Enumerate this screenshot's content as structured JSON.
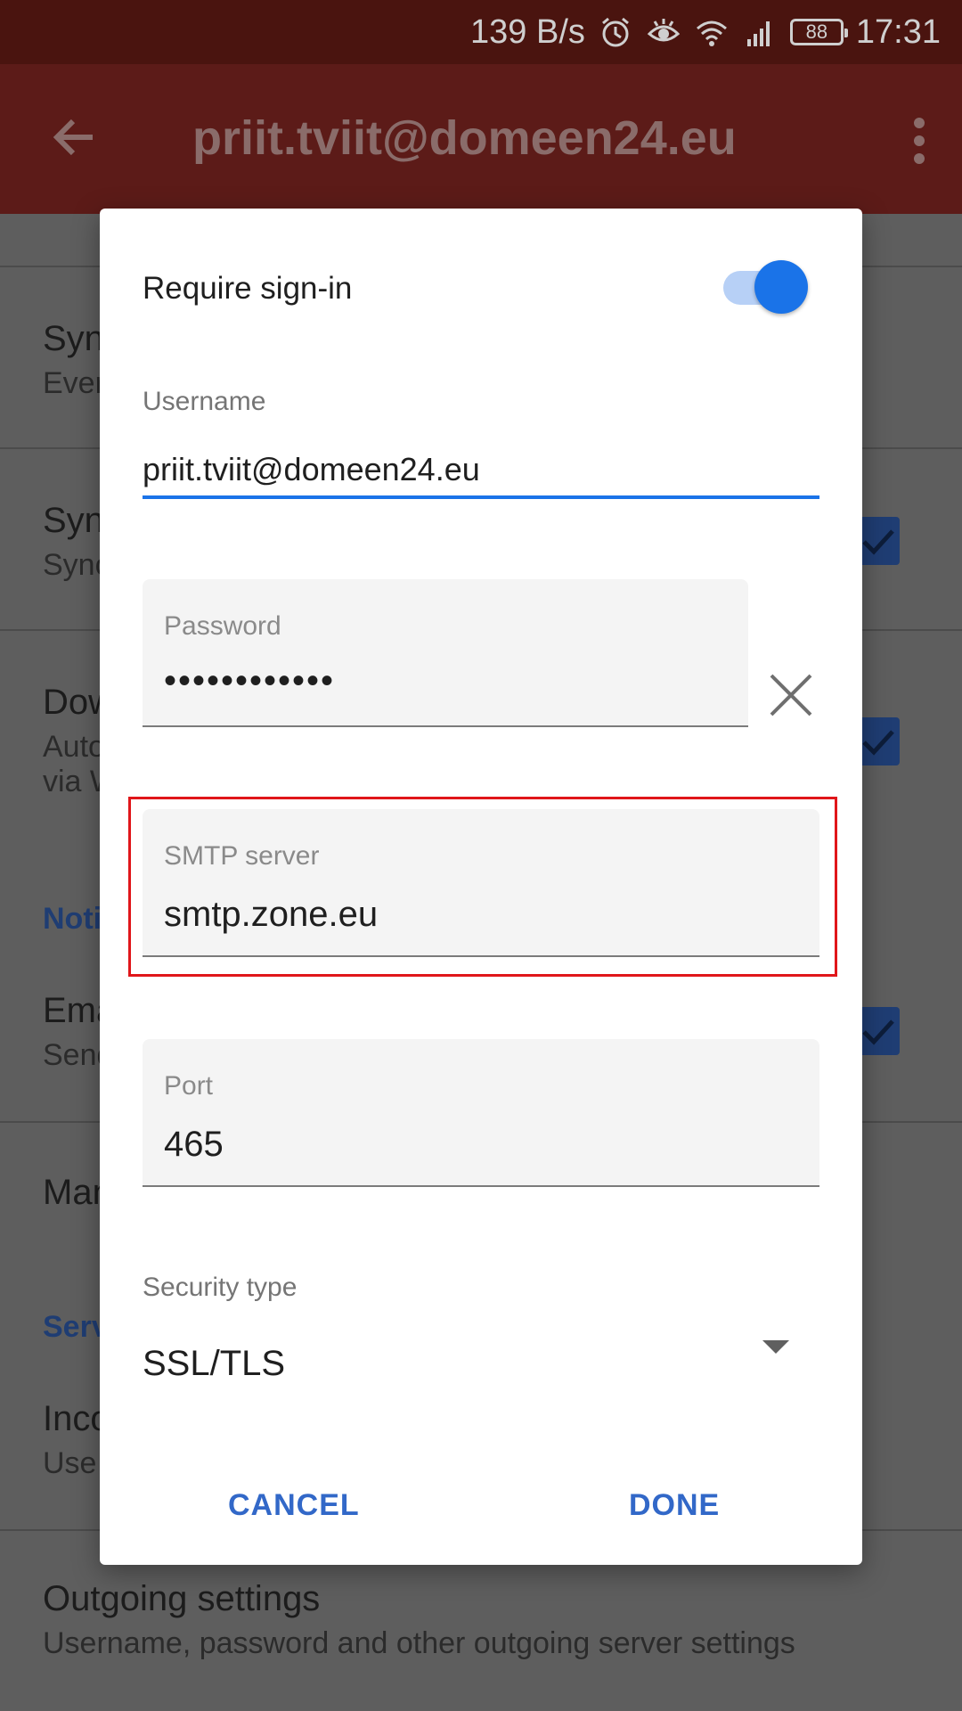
{
  "status_bar": {
    "speed": "139 B/s",
    "battery": "88",
    "time": "17:31"
  },
  "app_bar": {
    "title": "priit.tviit@domeen24.eu"
  },
  "background_list": {
    "sync_frequency": {
      "title": "Syn",
      "subtitle": "Ever"
    },
    "sync_email": {
      "title": "Syn",
      "subtitle": "Sync"
    },
    "download_attachments": {
      "title": "Dow",
      "subtitle": "Auto",
      "subtitle2": "via W"
    },
    "notifications_section": "Noti",
    "email_notifications": {
      "title": "Ema",
      "subtitle": "Send"
    },
    "manage": {
      "title": "Man"
    },
    "server_section": "Serv",
    "incoming": {
      "title": "Inco",
      "subtitle": "Use"
    },
    "outgoing": {
      "title": "Outgoing settings",
      "subtitle": "Username, password and other outgoing server settings"
    }
  },
  "dialog": {
    "require_signin_label": "Require sign-in",
    "require_signin_on": true,
    "username_label": "Username",
    "username_value": "priit.tviit@domeen24.eu",
    "password_label": "Password",
    "password_value": "••••••••••••",
    "smtp_label": "SMTP server",
    "smtp_value": "smtp.zone.eu",
    "port_label": "Port",
    "port_value": "465",
    "security_label": "Security type",
    "security_value": "SSL/TLS",
    "cancel_label": "CANCEL",
    "done_label": "DONE"
  },
  "colors": {
    "accent": "#1a73e8",
    "button_text": "#3268c8",
    "highlight_box": "#e0161a"
  }
}
